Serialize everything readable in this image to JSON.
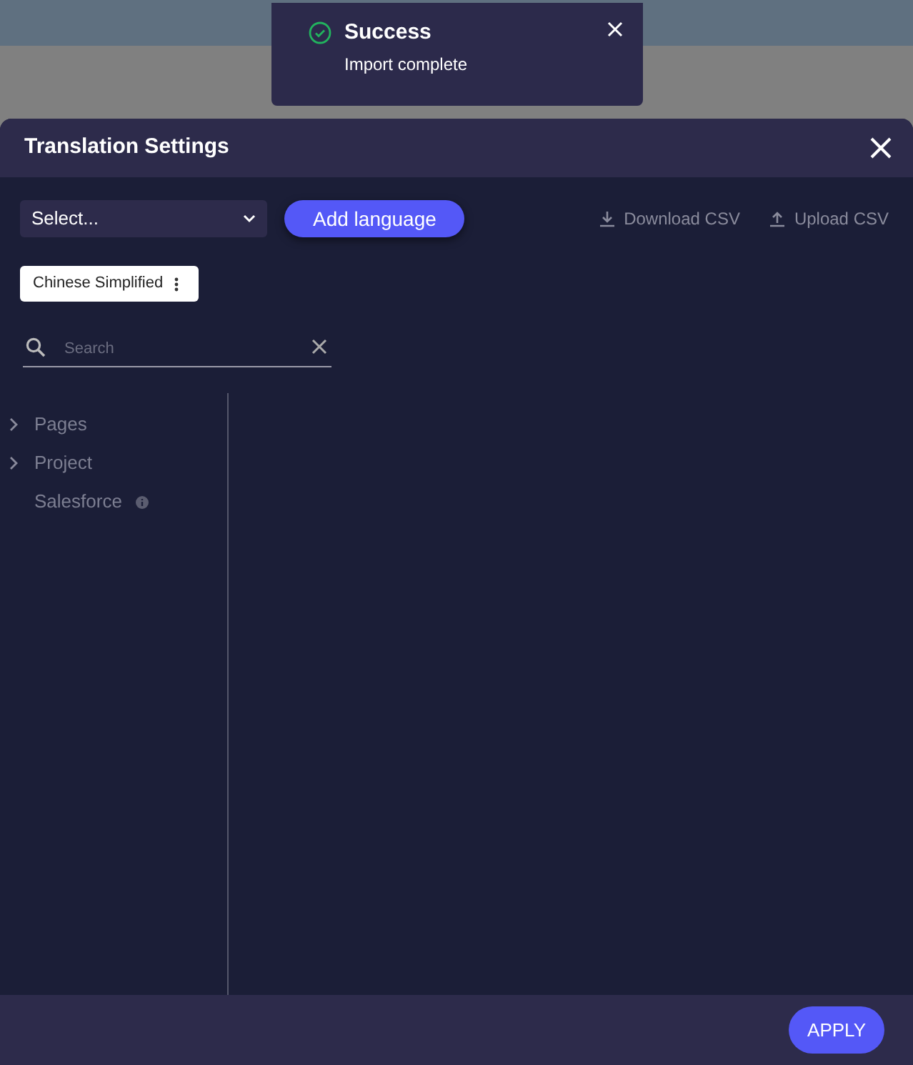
{
  "toast": {
    "title": "Success",
    "message": "Import complete"
  },
  "dialog": {
    "title": "Translation Settings",
    "toolbar": {
      "select": {
        "value": "Select..."
      },
      "add_button": "Add language",
      "links": [
        "Download CSV",
        "Upload CSV"
      ]
    },
    "languages": [
      {
        "label": "Chinese Simplified"
      }
    ],
    "search": {
      "placeholder": "Search"
    },
    "tree": [
      {
        "label": "Pages",
        "kind": "group",
        "expanded": false
      },
      {
        "label": "Project",
        "kind": "group",
        "expanded": false
      },
      {
        "label": "Salesforce",
        "kind": "info"
      }
    ],
    "footer": {
      "apply": "APPLY"
    }
  }
}
